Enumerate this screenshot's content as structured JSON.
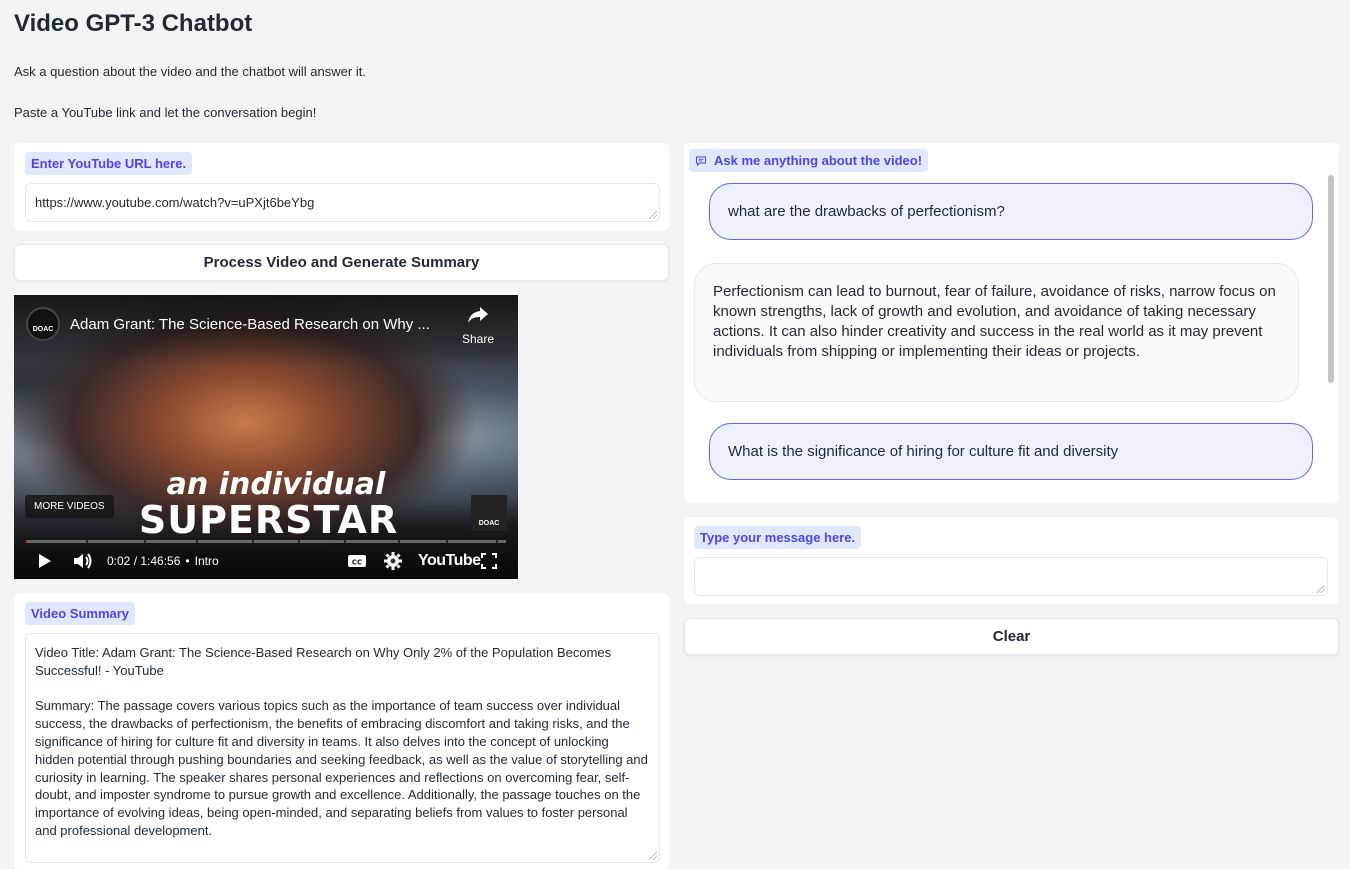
{
  "header": {
    "title": "Video GPT-3 Chatbot",
    "line1": "Ask a question about the video and the chatbot will answer it.",
    "line2": "Paste a YouTube link and let the conversation begin!"
  },
  "url_section": {
    "label": "Enter YouTube URL here.",
    "value": "https://www.youtube.com/watch?v=uPXjt6beYbg"
  },
  "process_button": "Process Video and Generate Summary",
  "video": {
    "channel": "DOAC",
    "title": "Adam Grant: The Science-Based Research on Why ...",
    "share_label": "Share",
    "overlay_line1": "an individual",
    "overlay_line2": "SUPERSTAR",
    "more_videos": "MORE VIDEOS",
    "time": "0:02 / 1:46:56",
    "chapter": "Intro",
    "youtube_logo": "YouTube",
    "progress": 0.0003
  },
  "summary_section": {
    "label": "Video Summary",
    "text": "Video Title: Adam Grant: The Science-Based Research on Why Only 2% of the Population Becomes Successful! - YouTube\n\nSummary: The passage covers various topics such as the importance of team success over individual success, the drawbacks of perfectionism, the benefits of embracing discomfort and taking risks, and the significance of hiring for culture fit and diversity in teams. It also delves into the concept of unlocking hidden potential through pushing boundaries and seeking feedback, as well as the value of storytelling and curiosity in learning. The speaker shares personal experiences and reflections on overcoming fear, self-doubt, and imposter syndrome to pursue growth and excellence. Additionally, the passage touches on the importance of evolving ideas, being open-minded, and separating beliefs from values to foster personal and professional development."
  },
  "chat": {
    "label": "Ask me anything about the video!",
    "messages": [
      {
        "role": "user",
        "text": "what are the drawbacks of perfectionism?"
      },
      {
        "role": "bot",
        "text": "Perfectionism can lead to burnout, fear of failure, avoidance of risks, narrow focus on known strengths, lack of growth and evolution, and avoidance of taking necessary actions. It can also hinder creativity and success in the real world as it may prevent individuals from shipping or implementing their ideas or projects."
      },
      {
        "role": "user",
        "text": "What is the significance of hiring for culture fit and diversity"
      }
    ]
  },
  "message_section": {
    "label": "Type your message here.",
    "value": ""
  },
  "clear_button": "Clear",
  "colors": {
    "accent": "#4f46e5",
    "badge_bg": "#e0e7ff",
    "user_bubble_border": "#6366f1",
    "user_bubble_bg": "#eef2ff"
  }
}
